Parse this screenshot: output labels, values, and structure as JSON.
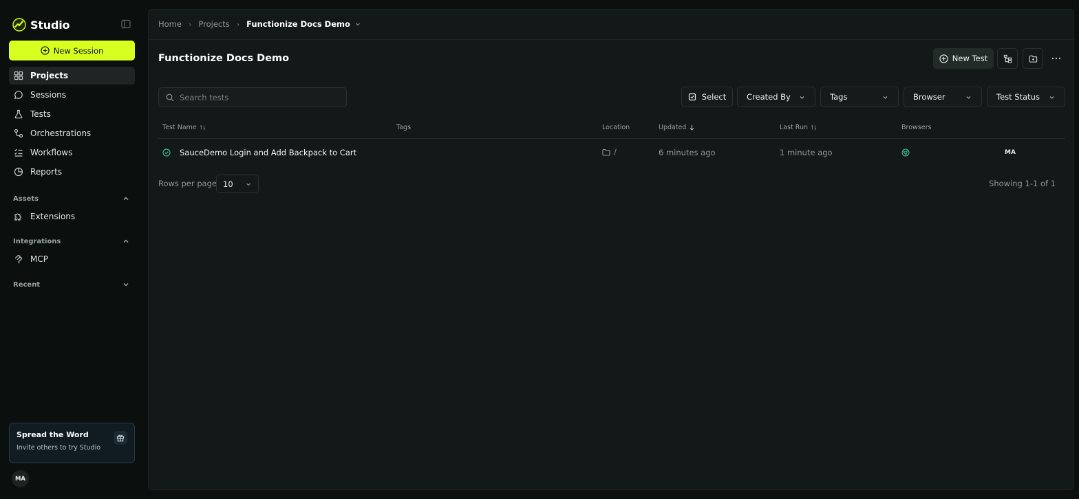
{
  "app": {
    "name": "Studio"
  },
  "sidebar": {
    "new_session_label": "New Session",
    "nav": [
      {
        "label": "Projects",
        "icon": "grid-icon",
        "active": true
      },
      {
        "label": "Sessions",
        "icon": "chat-icon"
      },
      {
        "label": "Tests",
        "icon": "flask-icon"
      },
      {
        "label": "Orchestrations",
        "icon": "flow-icon"
      },
      {
        "label": "Workflows",
        "icon": "list-check-icon"
      },
      {
        "label": "Reports",
        "icon": "pie-chart-icon"
      }
    ],
    "assets": {
      "title": "Assets",
      "expanded": true,
      "items": [
        {
          "label": "Extensions",
          "icon": "puzzle-icon"
        }
      ]
    },
    "integrations": {
      "title": "Integrations",
      "expanded": true,
      "items": [
        {
          "label": "MCP",
          "icon": "mcp-icon"
        }
      ]
    },
    "recent": {
      "title": "Recent",
      "expanded": false
    },
    "promo": {
      "title": "Spread the Word",
      "subtitle": "Invite others to try Studio"
    },
    "user_initials": "MA"
  },
  "breadcrumb": {
    "items": [
      "Home",
      "Projects"
    ],
    "current": "Functionize Docs Demo"
  },
  "page": {
    "title": "Functionize Docs Demo",
    "new_test_label": "New Test"
  },
  "search": {
    "placeholder": "Search tests",
    "value": ""
  },
  "filters": {
    "select": "Select",
    "created_by": "Created By",
    "tags": "Tags",
    "browser": "Browser",
    "test_status": "Test Status"
  },
  "table": {
    "columns": {
      "test_name": "Test Name",
      "tags": "Tags",
      "location": "Location",
      "updated": "Updated",
      "last_run": "Last Run",
      "browsers": "Browsers"
    },
    "rows": [
      {
        "status": "passed",
        "name": "SauceDemo Login and Add Backpack to Cart",
        "tags": "",
        "location": "/",
        "updated": "6 minutes ago",
        "last_run": "1 minute ago",
        "browser": "chrome-icon",
        "owner": "MA"
      }
    ]
  },
  "pagination": {
    "rows_label": "Rows per page",
    "rows_value": "10",
    "showing": "Showing 1-1 of 1"
  },
  "colors": {
    "accent": "#d7ff1f",
    "background": "#0b0f0e",
    "panel": "#121918",
    "success": "#3fb98a"
  }
}
